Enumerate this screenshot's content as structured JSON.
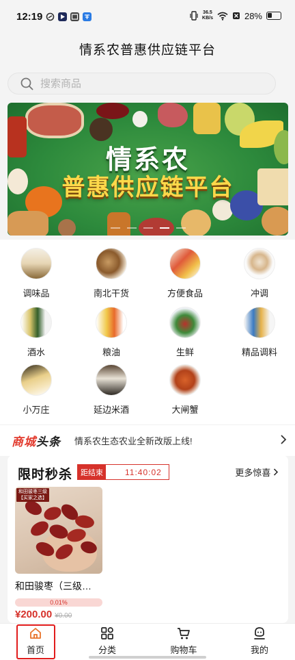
{
  "status_bar": {
    "time": "12:19",
    "net_speed_value": "36.5",
    "net_speed_unit": "KB/s",
    "battery": "28%"
  },
  "header": {
    "title": "情系农普惠供应链平台"
  },
  "search": {
    "placeholder": "搜索商品"
  },
  "banner": {
    "line1": "情系农",
    "line2": "普惠供应链平台",
    "slide_count": 5,
    "active_slide": 3
  },
  "categories": [
    {
      "label": "调味品",
      "icon": "seasoning-icon"
    },
    {
      "label": "南北干货",
      "icon": "dried-goods-icon"
    },
    {
      "label": "方便食品",
      "icon": "instant-food-icon"
    },
    {
      "label": "冲调",
      "icon": "beverage-mix-icon"
    },
    {
      "label": "酒水",
      "icon": "drinks-icon"
    },
    {
      "label": "粮油",
      "icon": "grain-oil-icon"
    },
    {
      "label": "生鲜",
      "icon": "fresh-produce-icon"
    },
    {
      "label": "精品调料",
      "icon": "premium-seasoning-icon"
    },
    {
      "label": "小万庄",
      "icon": "xiaowanzhuang-icon"
    },
    {
      "label": "延边米酒",
      "icon": "rice-wine-icon"
    },
    {
      "label": "大闸蟹",
      "icon": "crab-icon"
    }
  ],
  "news": {
    "logo_part1": "商城",
    "logo_part2": "头条",
    "text": "情系农生态农业全新改版上线!"
  },
  "flash_sale": {
    "title": "限时秒杀",
    "countdown_label": "距结束",
    "countdown_time": "11:40:02",
    "more_label": "更多惊喜",
    "products": [
      {
        "name": "和田骏枣（三级…",
        "tag": "和田骏枣三级",
        "tag_sub": "【买家之选】",
        "progress": "0.01%",
        "progress_value": 0.01,
        "price": "¥200.00",
        "old_price": "¥0.00"
      }
    ]
  },
  "bottom_nav": {
    "items": [
      {
        "label": "首页",
        "icon": "home-icon",
        "active": true
      },
      {
        "label": "分类",
        "icon": "category-grid-icon",
        "active": false
      },
      {
        "label": "购物车",
        "icon": "cart-icon",
        "active": false
      },
      {
        "label": "我的",
        "icon": "profile-icon",
        "active": false
      }
    ]
  },
  "colors": {
    "accent": "#d6322b",
    "highlight": "#e11b1b",
    "banner_green": "#2d8a3c",
    "banner_yellow": "#ffd84a"
  }
}
